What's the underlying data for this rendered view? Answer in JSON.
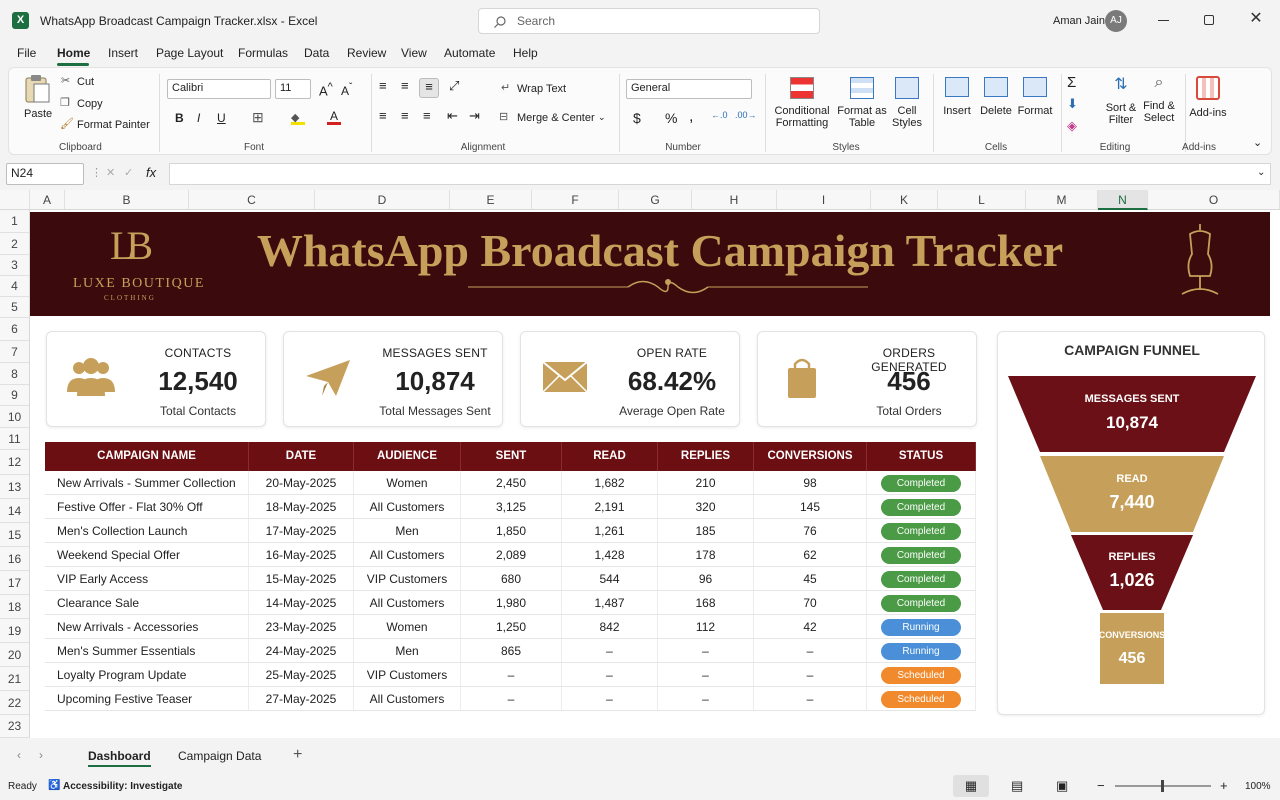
{
  "window": {
    "title": "WhatsApp Broadcast Campaign Tracker.xlsx  -  Excel",
    "search_placeholder": "Search",
    "user_name": "Aman Jain",
    "user_initials": "AJ"
  },
  "menu": [
    "File",
    "Home",
    "Insert",
    "Page Layout",
    "Formulas",
    "Data",
    "Review",
    "View",
    "Automate",
    "Help"
  ],
  "ribbon": {
    "clipboard": {
      "paste": "Paste",
      "cut": "Cut",
      "copy": "Copy",
      "format_painter": "Format Painter",
      "label": "Clipboard"
    },
    "font": {
      "family": "Calibri",
      "size": "11",
      "label": "Font"
    },
    "alignment": {
      "wrap": "Wrap Text",
      "merge": "Merge & Center",
      "label": "Alignment"
    },
    "number": {
      "format": "General",
      "label": "Number"
    },
    "styles": {
      "conditional1": "Conditional",
      "conditional2": "Formatting",
      "format_table1": "Format as",
      "format_table2": "Table",
      "cell_styles1": "Cell",
      "cell_styles2": "Styles",
      "label": "Styles"
    },
    "cells": {
      "insert": "Insert",
      "delete": "Delete",
      "format": "Format",
      "label": "Cells"
    },
    "editing": {
      "sort1": "Sort &",
      "sort2": "Filter",
      "find1": "Find &",
      "find2": "Select",
      "label": "Editing"
    },
    "addins": {
      "btn": "Add-ins",
      "label": "Add-ins"
    }
  },
  "formula_bar": {
    "name_box": "N24",
    "formula": ""
  },
  "columns": [
    "A",
    "B",
    "C",
    "D",
    "E",
    "F",
    "G",
    "H",
    "I",
    "K",
    "L",
    "M",
    "N",
    "O"
  ],
  "rows": [
    "1",
    "2",
    "3",
    "4",
    "5",
    "6",
    "7",
    "8",
    "9",
    "10",
    "11",
    "12",
    "13",
    "14",
    "15",
    "16",
    "17",
    "18",
    "19",
    "20",
    "21",
    "22",
    "23"
  ],
  "banner": {
    "title": "WhatsApp Broadcast Campaign Tracker",
    "logo_mark": "LB",
    "brand": "LUXE BOUTIQUE",
    "brand_sub": "CLOTHING"
  },
  "kpis": [
    {
      "title": "CONTACTS",
      "value": "12,540",
      "subtitle": "Total Contacts",
      "icon": "people-icon"
    },
    {
      "title": "MESSAGES SENT",
      "value": "10,874",
      "subtitle": "Total Messages Sent",
      "icon": "paper-plane-icon"
    },
    {
      "title": "OPEN RATE",
      "value": "68.42%",
      "subtitle": "Average Open Rate",
      "icon": "envelope-icon"
    },
    {
      "title": "ORDERS GENERATED",
      "value": "456",
      "subtitle": "Total Orders",
      "icon": "shopping-bag-icon"
    }
  ],
  "table": {
    "headers": [
      "CAMPAIGN NAME",
      "DATE",
      "AUDIENCE",
      "SENT",
      "READ",
      "REPLIES",
      "CONVERSIONS",
      "STATUS"
    ],
    "rows": [
      [
        "New Arrivals - Summer Collection",
        "20-May-2025",
        "Women",
        "2,450",
        "1,682",
        "210",
        "98",
        "Completed"
      ],
      [
        "Festive Offer - Flat 30% Off",
        "18-May-2025",
        "All Customers",
        "3,125",
        "2,191",
        "320",
        "145",
        "Completed"
      ],
      [
        "Men's Collection Launch",
        "17-May-2025",
        "Men",
        "1,850",
        "1,261",
        "185",
        "76",
        "Completed"
      ],
      [
        "Weekend Special Offer",
        "16-May-2025",
        "All Customers",
        "2,089",
        "1,428",
        "178",
        "62",
        "Completed"
      ],
      [
        "VIP Early Access",
        "15-May-2025",
        "VIP Customers",
        "680",
        "544",
        "96",
        "45",
        "Completed"
      ],
      [
        "Clearance Sale",
        "14-May-2025",
        "All Customers",
        "1,980",
        "1,487",
        "168",
        "70",
        "Completed"
      ],
      [
        "New Arrivals - Accessories",
        "23-May-2025",
        "Women",
        "1,250",
        "842",
        "112",
        "42",
        "Running"
      ],
      [
        "Men's Summer Essentials",
        "24-May-2025",
        "Men",
        "865",
        "–",
        "–",
        "–",
        "Running"
      ],
      [
        "Loyalty Program Update",
        "25-May-2025",
        "VIP Customers",
        "–",
        "–",
        "–",
        "–",
        "Scheduled"
      ],
      [
        "Upcoming Festive Teaser",
        "27-May-2025",
        "All Customers",
        "–",
        "–",
        "–",
        "–",
        "Scheduled"
      ]
    ],
    "status_colors": {
      "Completed": "#4a9a46",
      "Running": "#4a8fd8",
      "Scheduled": "#f08a2c"
    }
  },
  "funnel": {
    "title": "CAMPAIGN FUNNEL",
    "stages": [
      {
        "label": "MESSAGES SENT",
        "value": "10,874",
        "color": "#6b1016"
      },
      {
        "label": "READ",
        "value": "7,440",
        "color": "#c6a05a"
      },
      {
        "label": "REPLIES",
        "value": "1,026",
        "color": "#6b1016"
      },
      {
        "label": "CONVERSIONS",
        "value": "456",
        "color": "#c6a05a"
      }
    ]
  },
  "sheets": {
    "active": "Dashboard",
    "other": "Campaign Data"
  },
  "status": {
    "ready": "Ready",
    "accessibility": "Accessibility: Investigate",
    "zoom": "100%"
  },
  "colors": {
    "banner_bg": "#3a0a0c",
    "gold": "#c6a05a",
    "header_bg": "#6b0f12",
    "excel_green": "#1d6f42"
  }
}
